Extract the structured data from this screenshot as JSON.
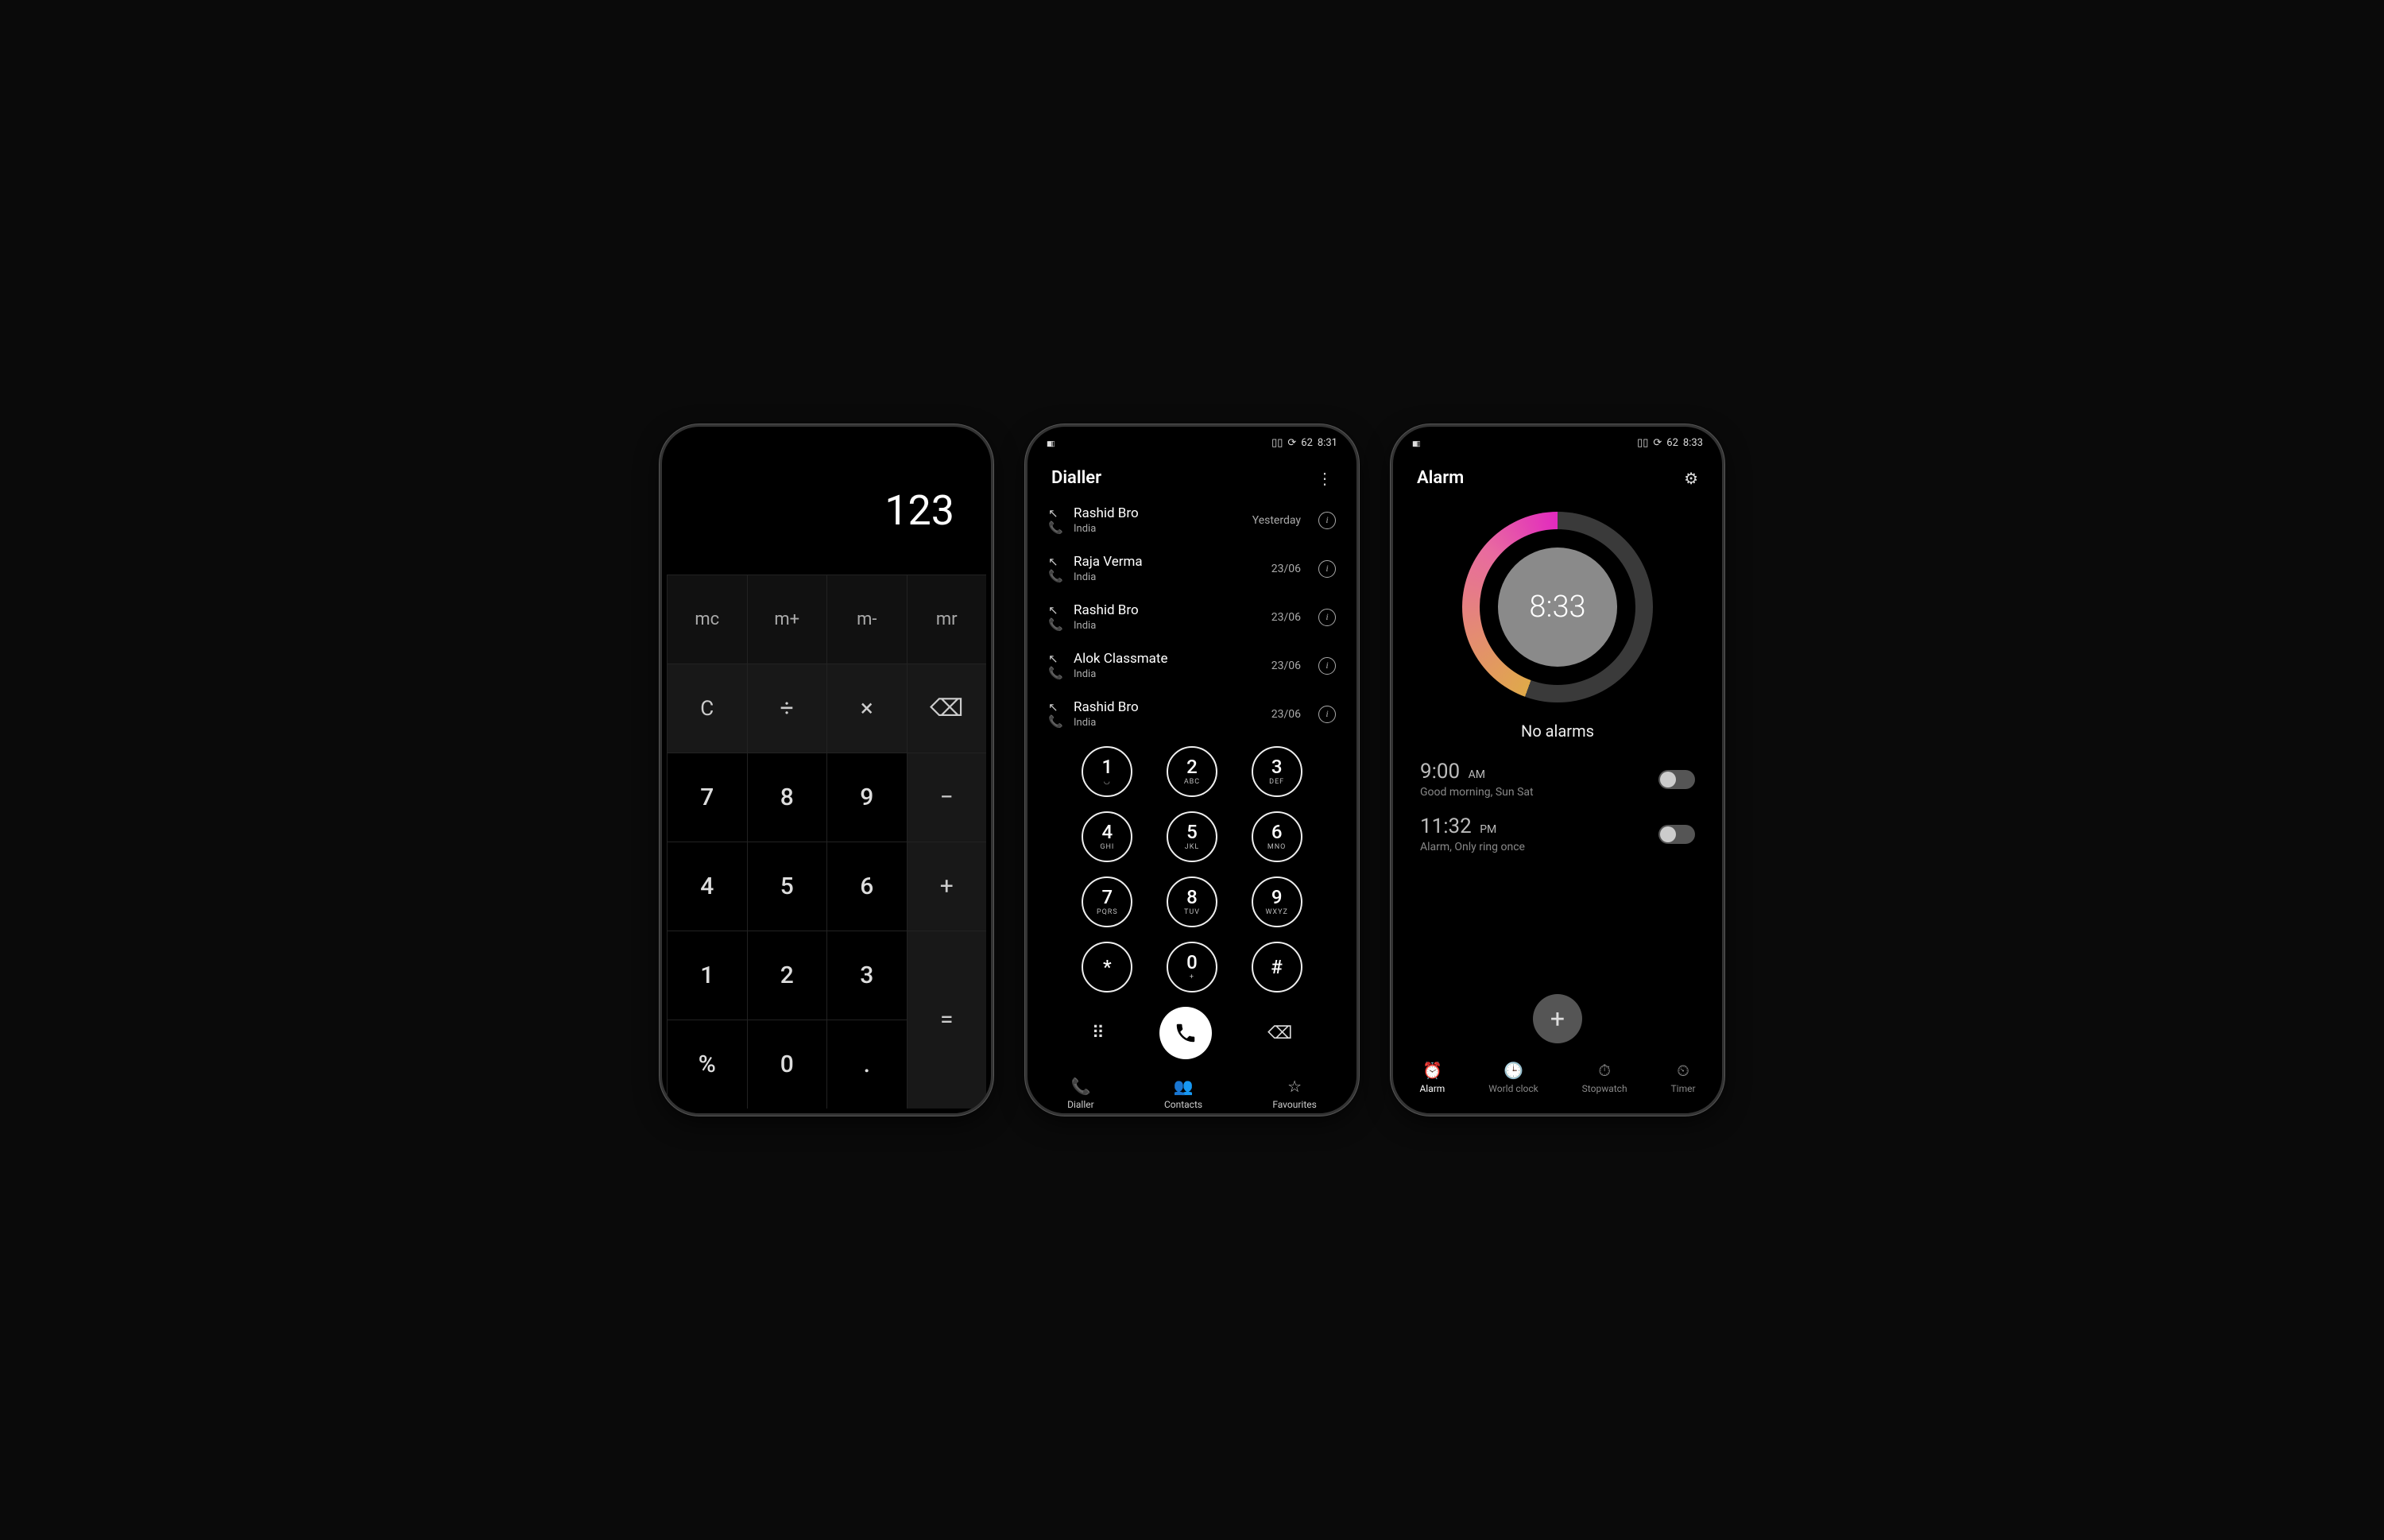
{
  "calculator": {
    "display_value": "123",
    "memory_keys": [
      "mc",
      "m+",
      "m-",
      "mr"
    ],
    "clear": "C",
    "divide": "÷",
    "multiply": "×",
    "backspace": "⌫",
    "minus": "−",
    "plus": "+",
    "equals": "=",
    "percent": "%",
    "dot": ".",
    "digits": {
      "7": "7",
      "8": "8",
      "9": "9",
      "4": "4",
      "5": "5",
      "6": "6",
      "1": "1",
      "2": "2",
      "3": "3",
      "0": "0"
    }
  },
  "dialler": {
    "status_time": "8:31",
    "battery_pct": "62",
    "title": "Dialler",
    "calls": [
      {
        "name": "Rashid Bro",
        "region": "India",
        "date": "Yesterday"
      },
      {
        "name": "Raja Verma",
        "region": "India",
        "date": "23/06"
      },
      {
        "name": "Rashid Bro",
        "region": "India",
        "date": "23/06"
      },
      {
        "name": "Alok Classmate",
        "region": "India",
        "date": "23/06"
      },
      {
        "name": "Rashid Bro",
        "region": "India",
        "date": "23/06"
      }
    ],
    "keys": [
      {
        "n": "1",
        "l": "◡"
      },
      {
        "n": "2",
        "l": "ABC"
      },
      {
        "n": "3",
        "l": "DEF"
      },
      {
        "n": "4",
        "l": "GHI"
      },
      {
        "n": "5",
        "l": "JKL"
      },
      {
        "n": "6",
        "l": "MNO"
      },
      {
        "n": "7",
        "l": "PQRS"
      },
      {
        "n": "8",
        "l": "TUV"
      },
      {
        "n": "9",
        "l": "WXYZ"
      },
      {
        "n": "*",
        "l": ""
      },
      {
        "n": "0",
        "l": "+"
      },
      {
        "n": "#",
        "l": ""
      }
    ],
    "tabs": [
      "Dialler",
      "Contacts",
      "Favourites"
    ]
  },
  "alarm": {
    "status_time": "8:33",
    "battery_pct": "62",
    "title": "Alarm",
    "clock_time": "8:33",
    "no_alarms_text": "No alarms",
    "alarms": [
      {
        "time": "9:00",
        "period": "AM",
        "desc": "Good morning, Sun Sat",
        "on": false
      },
      {
        "time": "11:32",
        "period": "PM",
        "desc": "Alarm, Only ring once",
        "on": false
      }
    ],
    "tabs": [
      "Alarm",
      "World clock",
      "Stopwatch",
      "Timer"
    ]
  }
}
